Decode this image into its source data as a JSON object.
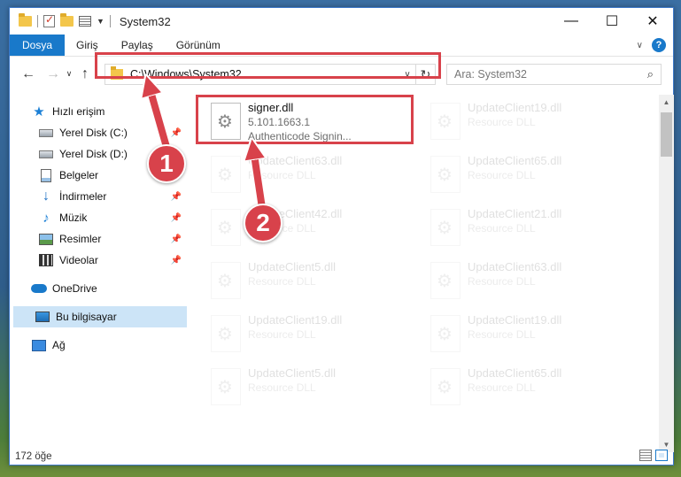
{
  "window": {
    "title": "System32"
  },
  "ribbon": {
    "tabs": [
      "Dosya",
      "Giriş",
      "Paylaş",
      "Görünüm"
    ],
    "help": "?"
  },
  "address": {
    "path": "C:\\Windows\\System32"
  },
  "search": {
    "placeholder": "Ara: System32"
  },
  "sidebar": {
    "items": [
      {
        "label": "Hızlı erişim",
        "icon": "star-icon"
      },
      {
        "label": "Yerel Disk (C:)",
        "icon": "drive-icon",
        "pinned": true
      },
      {
        "label": "Yerel Disk (D:)",
        "icon": "drive-icon",
        "pinned": true
      },
      {
        "label": "Belgeler",
        "icon": "document-icon",
        "pinned": true
      },
      {
        "label": "İndirmeler",
        "icon": "download-icon",
        "pinned": true
      },
      {
        "label": "Müzik",
        "icon": "music-icon",
        "pinned": true
      },
      {
        "label": "Resimler",
        "icon": "pictures-icon",
        "pinned": true
      },
      {
        "label": "Videolar",
        "icon": "video-icon",
        "pinned": true
      },
      {
        "label": "OneDrive",
        "icon": "cloud-icon"
      },
      {
        "label": "Bu bilgisayar",
        "icon": "computer-icon",
        "selected": true
      },
      {
        "label": "Ağ",
        "icon": "network-icon"
      }
    ]
  },
  "files": [
    {
      "name": "signer.dll",
      "line1": "5.101.1663.1",
      "line2": "Authenticode Signin...",
      "highlighted": true
    },
    {
      "name": "UpdateClient19.dll",
      "line1": "Resource DLL",
      "faded": true
    },
    {
      "name": "UpdateClient63.dll",
      "line1": "Resource DLL",
      "faded": true
    },
    {
      "name": "UpdateClient65.dll",
      "line1": "Resource DLL",
      "faded": true
    },
    {
      "name": "UpdateClient42.dll",
      "line1": "Resource DLL",
      "faded": true
    },
    {
      "name": "UpdateClient21.dll",
      "line1": "Resource DLL",
      "faded": true
    },
    {
      "name": "UpdateClient5.dll",
      "line1": "Resource DLL",
      "faded": true
    },
    {
      "name": "UpdateClient63.dll",
      "line1": "Resource DLL",
      "faded": true
    },
    {
      "name": "UpdateClient19.dll",
      "line1": "Resource DLL",
      "faded": true
    },
    {
      "name": "UpdateClient19.dll",
      "line1": "Resource DLL",
      "faded": true
    },
    {
      "name": "UpdateClient5.dll",
      "line1": "Resource DLL",
      "faded": true
    },
    {
      "name": "UpdateClient65.dll",
      "line1": "Resource DLL",
      "faded": true
    }
  ],
  "status": {
    "count": "172 öğe"
  },
  "annotations": {
    "badge1": "1",
    "badge2": "2",
    "color": "#d8424b"
  }
}
